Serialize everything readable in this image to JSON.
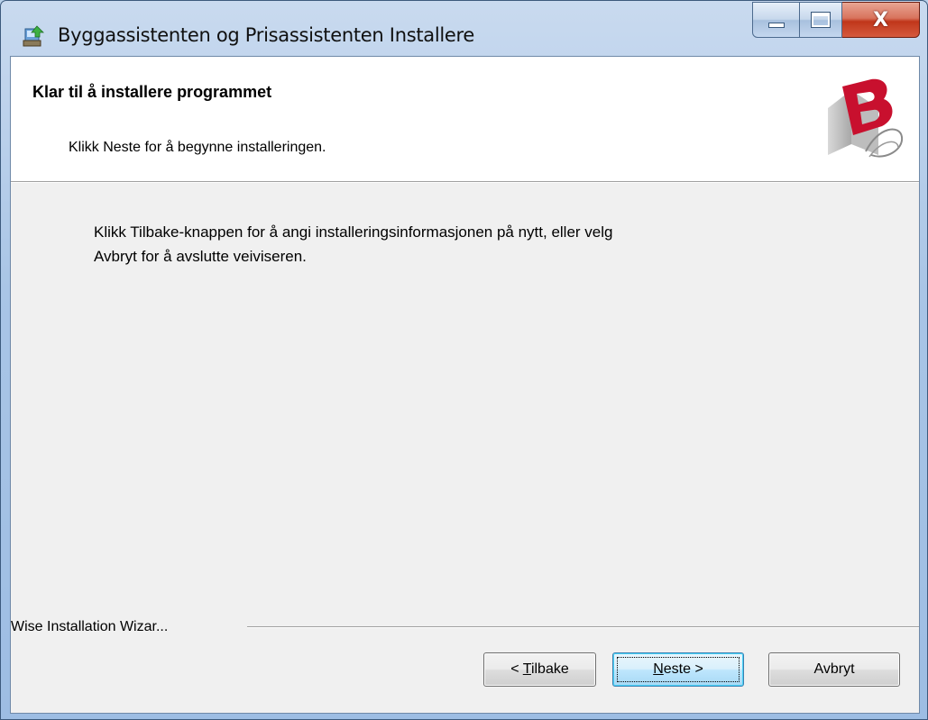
{
  "window": {
    "title": "Byggassistenten og Prisassistenten Installere",
    "close_glyph": "X"
  },
  "header": {
    "title": "Klar til å installere programmet",
    "subtitle": "Klikk Neste for å begynne installeringen."
  },
  "body": {
    "line1": "Klikk Tilbake-knappen for å angi installeringsinformasjonen på nytt, eller velg",
    "line2": "Avbryt for å avslutte veiviseren."
  },
  "footer": {
    "brand_label": "Wise Installation Wizar..."
  },
  "buttons": {
    "back_prefix": "< ",
    "back_mnemonic": "T",
    "back_rest": "ilbake",
    "next_mnemonic": "N",
    "next_rest": "este >",
    "cancel": "Avbryt"
  },
  "icons": {
    "app": "installer-icon",
    "logo": "b-logo-icon",
    "minimize": "minimize-icon",
    "maximize": "maximize-icon",
    "close": "close-icon"
  },
  "colors": {
    "logo_red": "#c8102e",
    "close_red": "#c0361a",
    "frame_blue": "#a9c5e6"
  }
}
